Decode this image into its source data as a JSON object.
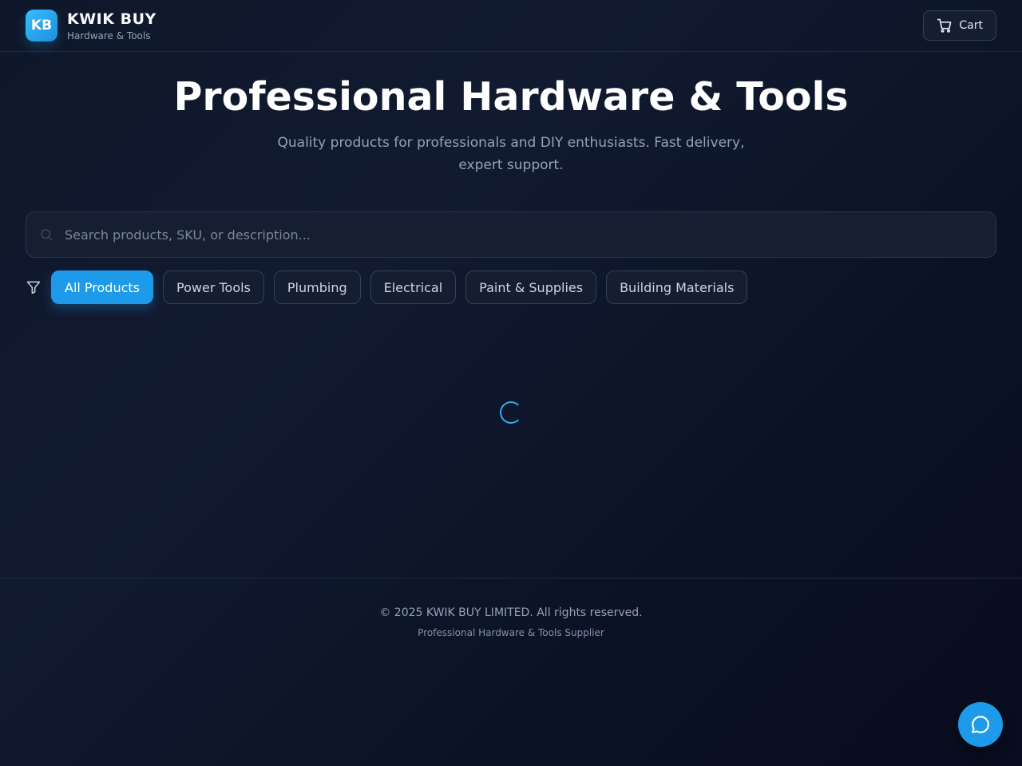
{
  "header": {
    "logo_text": "KB",
    "brand_name": "KWIK BUY",
    "brand_sub": "Hardware & Tools",
    "cart_label": "Cart"
  },
  "hero": {
    "title": "Professional Hardware & Tools",
    "subtitle": "Quality products for professionals and DIY enthusiasts. Fast delivery, expert support."
  },
  "search": {
    "placeholder": "Search products, SKU, or description...",
    "value": ""
  },
  "filters": {
    "icon": "filter-icon",
    "categories": [
      {
        "label": "All Products",
        "active": true
      },
      {
        "label": "Power Tools",
        "active": false
      },
      {
        "label": "Plumbing",
        "active": false
      },
      {
        "label": "Electrical",
        "active": false
      },
      {
        "label": "Paint & Supplies",
        "active": false
      },
      {
        "label": "Building Materials",
        "active": false
      }
    ]
  },
  "footer": {
    "copyright": "© 2025 KWIK BUY LIMITED. All rights reserved.",
    "tagline": "Professional Hardware & Tools Supplier"
  },
  "colors": {
    "accent": "#1d9bea",
    "background": "#0f172a"
  },
  "icons": [
    "cart-icon",
    "search-icon",
    "filter-icon",
    "loading-spinner-icon",
    "chat-icon"
  ]
}
